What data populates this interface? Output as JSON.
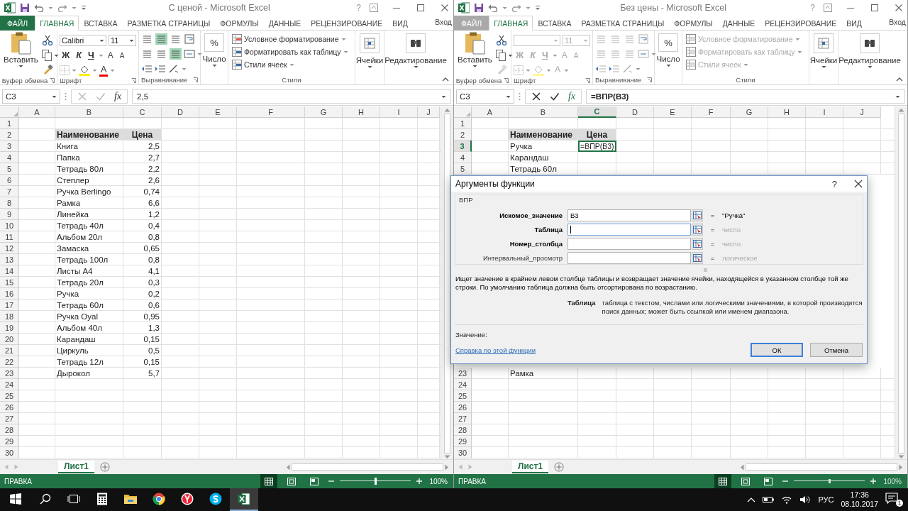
{
  "windows": [
    {
      "title": "С ценой - Microsoft Excel",
      "help": "?",
      "editing": false,
      "tabs": [
        {
          "label": "ФАЙЛ",
          "kind": "file",
          "selected": false
        },
        {
          "label": "ГЛАВНАЯ",
          "kind": "tab",
          "selected": true
        },
        {
          "label": "ВСТАВКА",
          "kind": "tab",
          "selected": false
        },
        {
          "label": "РАЗМЕТКА СТРАНИЦЫ",
          "kind": "tab",
          "selected": false
        },
        {
          "label": "ФОРМУЛЫ",
          "kind": "tab",
          "selected": false
        },
        {
          "label": "ДАННЫЕ",
          "kind": "tab",
          "selected": false
        },
        {
          "label": "РЕЦЕНЗИРОВАНИЕ",
          "kind": "tab",
          "selected": false
        },
        {
          "label": "ВИД",
          "kind": "tab",
          "selected": false
        }
      ],
      "sign_in": "Вход",
      "ribbon": {
        "paste": "Вставить",
        "clipboard_label": "Буфер обмена",
        "font_name": "Calibri",
        "font_size": "11",
        "style_buttons": [
          "Ж",
          "К",
          "Ч"
        ],
        "size_buttons": [
          "A",
          "A"
        ],
        "font_color": "A",
        "font_label": "Шрифт",
        "alignment_label": "Выравнивание",
        "percent": "%",
        "number": "Число",
        "styles": [
          "Условное форматирование",
          "Форматировать как таблицу",
          "Стили ячеек"
        ],
        "styles_label": "Стили",
        "cells": "Ячейки",
        "editing": "Редактирование"
      },
      "name_box": "C3",
      "fx": "fx",
      "formula": "2,5",
      "columns": [
        {
          "label": "A",
          "selected": false
        },
        {
          "label": "B",
          "selected": false
        },
        {
          "label": "C",
          "selected": false
        },
        {
          "label": "D",
          "selected": false
        },
        {
          "label": "E",
          "selected": false
        },
        {
          "label": "F",
          "selected": false
        },
        {
          "label": "G",
          "selected": false
        },
        {
          "label": "H",
          "selected": false
        },
        {
          "label": "I",
          "selected": false
        },
        {
          "label": "J",
          "selected": false
        }
      ],
      "rows_top": [
        {
          "number": "1",
          "selected": false
        },
        {
          "number": "2",
          "kind": "header",
          "selected": false,
          "col_b": "Наименование",
          "col_c": "Цена"
        },
        {
          "number": "3",
          "kind": "data",
          "selected": false,
          "col_b": "Книга",
          "col_c": "2,5"
        },
        {
          "number": "4",
          "kind": "data",
          "selected": false,
          "col_b": "Папка",
          "col_c": "2,7"
        },
        {
          "number": "5",
          "kind": "data",
          "selected": false,
          "col_b": "Тетрадь 80л",
          "col_c": "2,2"
        },
        {
          "number": "6",
          "kind": "data",
          "selected": false,
          "col_b": "Степлер",
          "col_c": "2,6"
        },
        {
          "number": "7",
          "kind": "data",
          "selected": false,
          "col_b": "Ручка Berlingo",
          "col_c": "0,74"
        },
        {
          "number": "8",
          "kind": "data",
          "selected": false,
          "col_b": "Рамка",
          "col_c": "6,6"
        },
        {
          "number": "9",
          "kind": "data",
          "selected": false,
          "col_b": "Линейка",
          "col_c": "1,2"
        },
        {
          "number": "10",
          "kind": "data",
          "selected": false,
          "col_b": "Тетрадь 40л",
          "col_c": "0,4"
        },
        {
          "number": "11",
          "kind": "data",
          "selected": false,
          "col_b": "Альбом 20л",
          "col_c": "0,8"
        },
        {
          "number": "12",
          "kind": "data",
          "selected": false,
          "col_b": "Замаска",
          "col_c": "0,65"
        },
        {
          "number": "13",
          "kind": "data",
          "selected": false,
          "col_b": "Тетрадь 100л",
          "col_c": "0,8"
        },
        {
          "number": "14",
          "kind": "data",
          "selected": false,
          "col_b": "Листы А4",
          "col_c": "4,1"
        },
        {
          "number": "15",
          "kind": "data",
          "selected": false,
          "col_b": "Тетрадь 20л",
          "col_c": "0,3"
        },
        {
          "number": "16",
          "kind": "data",
          "selected": false,
          "col_b": "Ручка",
          "col_c": "0,2"
        },
        {
          "number": "17",
          "kind": "data",
          "selected": false,
          "col_b": "Тетрадь 60л",
          "col_c": "0,6"
        },
        {
          "number": "18",
          "kind": "data",
          "selected": false,
          "col_b": "Ручка Oyal",
          "col_c": "0,95"
        },
        {
          "number": "19",
          "kind": "data",
          "selected": false,
          "col_b": "Альбом 40л",
          "col_c": "1,3"
        },
        {
          "number": "20",
          "kind": "data",
          "selected": false,
          "col_b": "Карандаш",
          "col_c": "0,15"
        },
        {
          "number": "21",
          "kind": "data",
          "selected": false,
          "col_b": "Циркуль",
          "col_c": "0,5"
        },
        {
          "number": "22",
          "kind": "data",
          "selected": false,
          "col_b": "Тетрадь 12л",
          "col_c": "0,15"
        },
        {
          "number": "23",
          "kind": "data",
          "selected": false,
          "col_b": "Дырокол",
          "col_c": "5,7"
        },
        {
          "number": "24",
          "selected": false
        },
        {
          "number": "25",
          "selected": false
        },
        {
          "number": "26",
          "selected": false
        },
        {
          "number": "27",
          "selected": false
        },
        {
          "number": "28",
          "selected": false
        },
        {
          "number": "29",
          "selected": false
        },
        {
          "number": "30",
          "selected": false
        }
      ],
      "sheet_tabs": [
        {
          "label": "Лист1",
          "selected": true
        }
      ],
      "status": "ПРАВКА",
      "views": [
        {
          "kind": "normal",
          "selected": true
        },
        {
          "kind": "layout",
          "selected": false
        },
        {
          "kind": "pagebreak",
          "selected": false
        }
      ],
      "zoom": {
        "level": 0.5,
        "reading": "100%"
      }
    },
    {
      "title": "Без цены - Microsoft Excel",
      "help": "?",
      "editing": true,
      "tabs": [
        {
          "label": "ФАЙЛ",
          "kind": "file",
          "selected": false
        },
        {
          "label": "ГЛАВНАЯ",
          "kind": "tab",
          "selected": true
        },
        {
          "label": "ВСТАВКА",
          "kind": "tab",
          "selected": false
        },
        {
          "label": "РАЗМЕТКА СТРАНИЦЫ",
          "kind": "tab",
          "selected": false
        },
        {
          "label": "ФОРМУЛЫ",
          "kind": "tab",
          "selected": false
        },
        {
          "label": "ДАННЫЕ",
          "kind": "tab",
          "selected": false
        },
        {
          "label": "РЕЦЕНЗИРОВАНИЕ",
          "kind": "tab",
          "selected": false
        },
        {
          "label": "ВИД",
          "kind": "tab",
          "selected": false
        }
      ],
      "sign_in": "Вход",
      "ribbon": {
        "paste": "Вставить",
        "clipboard_label": "Буфер обмена",
        "font_size": "11",
        "style_buttons": [
          "Ж",
          "К",
          "Ч"
        ],
        "size_buttons": [
          "A",
          "A"
        ],
        "font_color": "A",
        "font_label": "Шрифт",
        "alignment_label": "Выравнивание",
        "percent": "%",
        "number": "Число",
        "styles": [
          "Условное форматирование",
          "Форматировать как таблицу",
          "Стили ячеек"
        ],
        "styles_label": "Стили",
        "cells": "Ячейки",
        "editing": "Редактирование"
      },
      "name_box": "C3",
      "fx": "fx",
      "formula": "=ВПР(B3)",
      "columns": [
        {
          "label": "A",
          "selected": false
        },
        {
          "label": "B",
          "selected": false
        },
        {
          "label": "C",
          "selected": true
        },
        {
          "label": "D",
          "selected": false
        },
        {
          "label": "E",
          "selected": false
        },
        {
          "label": "F",
          "selected": false
        },
        {
          "label": "G",
          "selected": false
        },
        {
          "label": "H",
          "selected": false
        },
        {
          "label": "I",
          "selected": false
        },
        {
          "label": "J",
          "selected": false
        }
      ],
      "rows_top": [
        {
          "number": "1",
          "selected": false
        },
        {
          "number": "2",
          "kind": "header",
          "selected": false,
          "col_b": "Наименование",
          "col_c": "Цена"
        },
        {
          "number": "3",
          "kind": "data",
          "selected": true,
          "col_b": "Ручка",
          "col_c": "=ВПР(B3)",
          "c_active": true
        },
        {
          "number": "4",
          "kind": "data",
          "selected": false,
          "col_b": "Карандаш"
        },
        {
          "number": "5",
          "kind": "data",
          "selected": false,
          "col_b": "Тетрадь 60л"
        }
      ],
      "rows_bottom": [
        {
          "number": "23",
          "selected": false,
          "col_b": "Рамка"
        },
        {
          "number": "24",
          "selected": false
        },
        {
          "number": "25",
          "selected": false
        },
        {
          "number": "26",
          "selected": false
        },
        {
          "number": "27",
          "selected": false
        },
        {
          "number": "28",
          "selected": false
        },
        {
          "number": "29",
          "selected": false
        },
        {
          "number": "30",
          "selected": false
        }
      ],
      "sheet_tabs": [
        {
          "label": "Лист1",
          "selected": true
        }
      ],
      "status": "ПРАВКА",
      "views": [
        {
          "kind": "normal",
          "selected": true
        },
        {
          "kind": "layout",
          "selected": false
        },
        {
          "kind": "pagebreak",
          "selected": false
        }
      ],
      "zoom": {
        "level": 0.5,
        "reading": "100%"
      }
    }
  ],
  "dialog": {
    "title": "Аргументы функции",
    "help": "?",
    "function_name": "ВПР",
    "arguments": [
      {
        "label": "Искомое_значение",
        "required": true,
        "value": "B3",
        "focused": false,
        "equals": "=",
        "result": "\"Ручка\"",
        "evaluated": true
      },
      {
        "label": "Таблица",
        "required": true,
        "focused": true,
        "equals": "=",
        "result": "число",
        "evaluated": false
      },
      {
        "label": "Номер_столбца",
        "required": true,
        "focused": false,
        "equals": "=",
        "result": "число",
        "evaluated": false
      },
      {
        "label": "Интервальный_просмотр",
        "required": false,
        "focused": false,
        "equals": "=",
        "result": "логическое",
        "evaluated": false
      }
    ],
    "description": "Ищет значение в крайнем левом столбце таблицы и возвращает значение ячейки, находящейся в указанном столбце той же строки. По умолчанию таблица должна быть отсортирована по возрастанию.",
    "arg_name": "Таблица",
    "arg_description": "таблица с текстом, числами или логическими значениями, в которой производится поиск данных; может быть ссылкой или именем диапазона.",
    "value_label": "Значение:",
    "help_link": "Справка по этой функции",
    "buttons": [
      {
        "label": "ОК",
        "default": true
      },
      {
        "label": "Отмена",
        "default": false
      }
    ]
  },
  "taskbar": {
    "apps": [
      {
        "kind": "start",
        "active": false
      },
      {
        "kind": "search",
        "active": false
      },
      {
        "kind": "taskview",
        "active": false
      },
      {
        "kind": "calculator",
        "active": false
      },
      {
        "kind": "explorer",
        "active": false
      },
      {
        "kind": "chrome",
        "active": false
      },
      {
        "kind": "yandex",
        "active": false
      },
      {
        "kind": "skype",
        "active": false
      },
      {
        "kind": "excel",
        "active": true
      }
    ],
    "language": "РУС",
    "time": "17:36",
    "date": "08.10.2017",
    "notifications": "1"
  }
}
